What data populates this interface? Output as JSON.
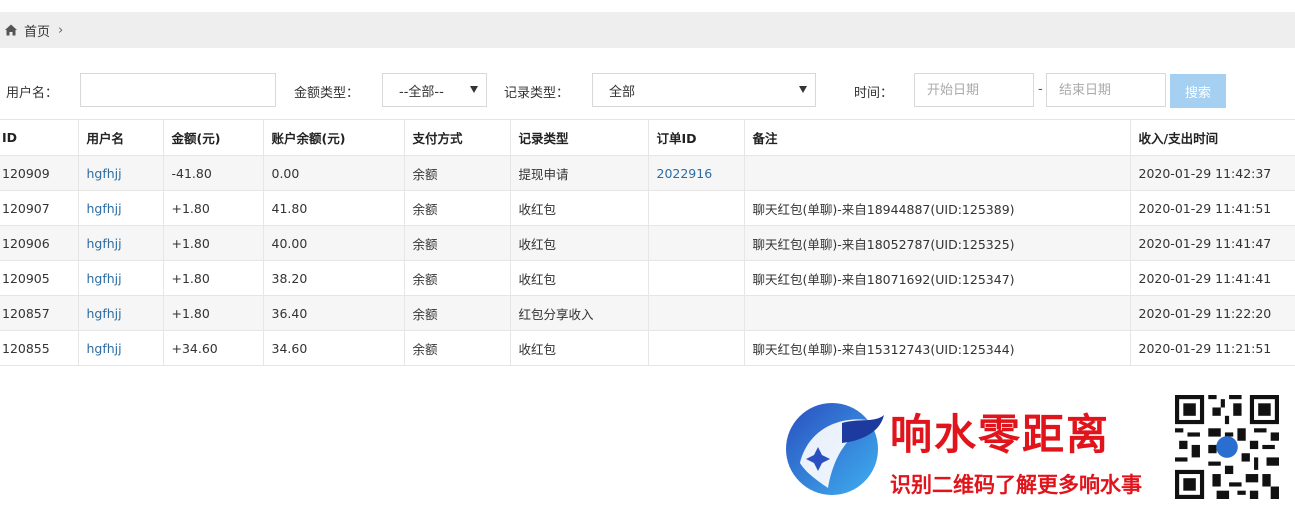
{
  "breadcrumb": {
    "home_label": "首页"
  },
  "filters": {
    "username_label": "用户名：",
    "username_value": "",
    "amount_type_label": "金额类型：",
    "amount_type_value": "--全部--",
    "record_type_label": "记录类型：",
    "record_type_value": "全部",
    "time_label": "时间：",
    "start_date_placeholder": "开始日期",
    "end_date_placeholder": "结束日期",
    "date_separator": "-",
    "search_label": "搜索",
    "search_color": "#a6d0f2"
  },
  "table": {
    "columns": [
      "ID",
      "用户名",
      "金额(元)",
      "账户余额(元)",
      "支付方式",
      "记录类型",
      "订单ID",
      "备注",
      "收入/支出时间"
    ],
    "rows": [
      [
        "120909",
        "hgfhjj",
        "-41.80",
        "0.00",
        "余额",
        "提现申请",
        "2022916",
        "",
        "2020-01-29 11:42:37"
      ],
      [
        "120907",
        "hgfhjj",
        "+1.80",
        "41.80",
        "余额",
        "收红包",
        "",
        "聊天红包(单聊)-来自18944887(UID:125389)",
        "2020-01-29 11:41:51"
      ],
      [
        "120906",
        "hgfhjj",
        "+1.80",
        "40.00",
        "余额",
        "收红包",
        "",
        "聊天红包(单聊)-来自18052787(UID:125325)",
        "2020-01-29 11:41:47"
      ],
      [
        "120905",
        "hgfhjj",
        "+1.80",
        "38.20",
        "余额",
        "收红包",
        "",
        "聊天红包(单聊)-来自18071692(UID:125347)",
        "2020-01-29 11:41:41"
      ],
      [
        "120857",
        "hgfhjj",
        "+1.80",
        "36.40",
        "余额",
        "红包分享收入",
        "",
        "",
        "2020-01-29 11:22:20"
      ],
      [
        "120855",
        "hgfhjj",
        "+34.60",
        "34.60",
        "余额",
        "收红包",
        "",
        "聊天红包(单聊)-来自15312743(UID:125344)",
        "2020-01-29 11:21:51"
      ]
    ]
  },
  "watermark": {
    "title": "响水零距离",
    "subtitle": "识别二维码了解更多响水事",
    "color": "#e1131b"
  }
}
